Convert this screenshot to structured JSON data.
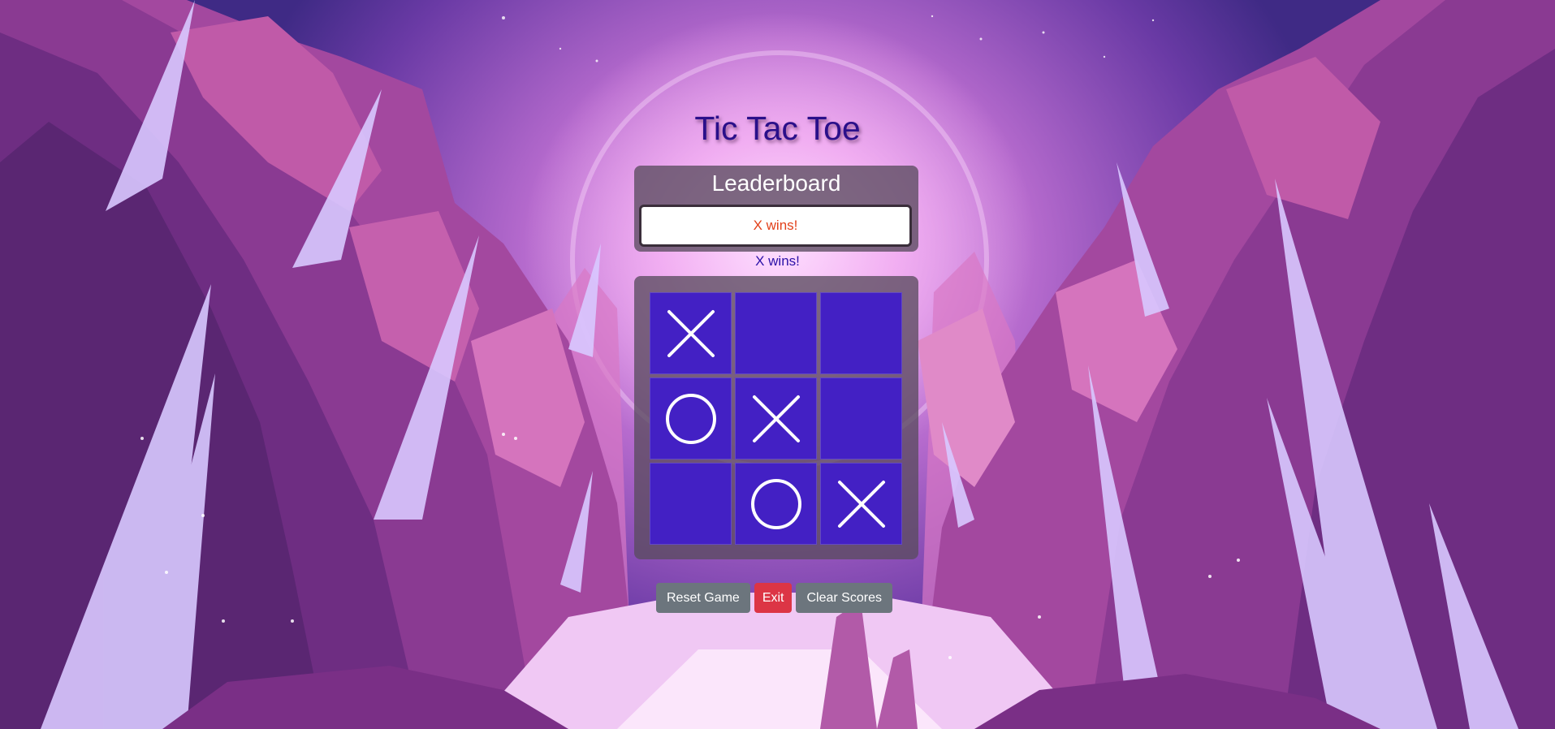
{
  "game": {
    "title": "Tic Tac Toe",
    "status": "X wins!"
  },
  "leaderboard": {
    "title": "Leaderboard",
    "result": "X wins!"
  },
  "board": {
    "cells": [
      "X",
      "",
      "",
      "O",
      "X",
      "",
      "",
      "O",
      "X"
    ]
  },
  "buttons": {
    "reset": "Reset Game",
    "exit": "Exit",
    "clear": "Clear Scores"
  },
  "colors": {
    "cell": "#4320c4",
    "title": "#2a0f8a",
    "result_text": "#e2401a",
    "status_text": "#2c12a8",
    "exit_button": "#dc3545",
    "gray_button": "#6c757d"
  }
}
